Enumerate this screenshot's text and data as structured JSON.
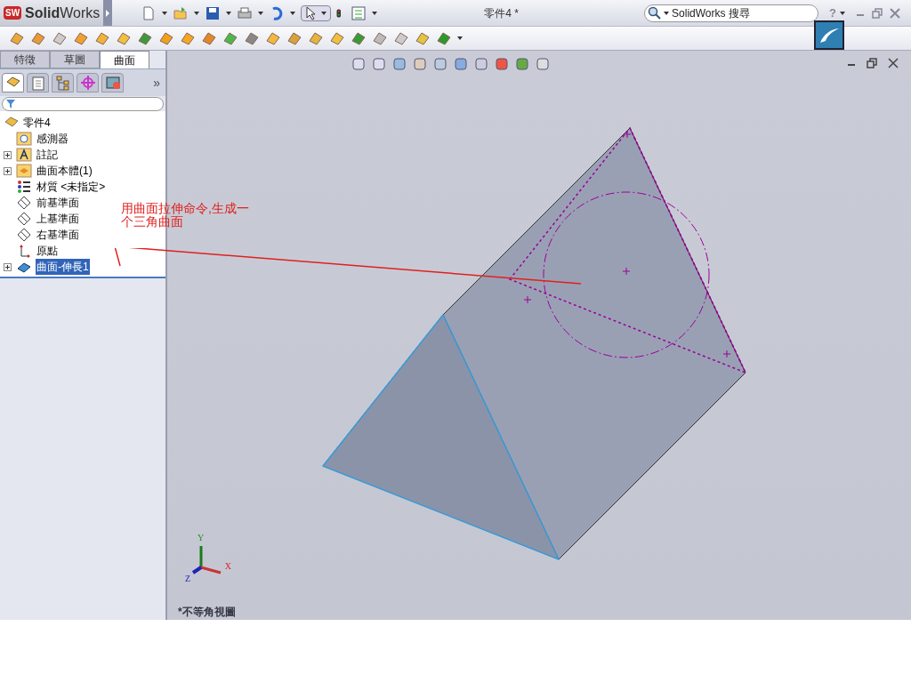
{
  "app": {
    "badge": "SW",
    "name_bold": "Solid",
    "name_rest": "Works"
  },
  "window": {
    "title": "零件4 *"
  },
  "search": {
    "placeholder": "SolidWorks 搜尋"
  },
  "help": "?",
  "tabs": [
    {
      "label": "特徵",
      "selected": false
    },
    {
      "label": "草圖",
      "selected": false
    },
    {
      "label": "曲面",
      "selected": true
    }
  ],
  "panel_tabs": [
    {
      "kind": "tree",
      "selected": true
    },
    {
      "kind": "properties",
      "selected": false
    },
    {
      "kind": "config",
      "selected": false
    },
    {
      "kind": "target",
      "selected": false
    },
    {
      "kind": "display",
      "selected": false
    }
  ],
  "panel_more": "»",
  "tree": {
    "label": "零件4",
    "kind": "part",
    "children": [
      {
        "label": "感測器",
        "kind": "sensor",
        "expandable": false,
        "selected": false
      },
      {
        "label": "註記",
        "kind": "annotation",
        "expandable": true,
        "expanded": false,
        "selected": false
      },
      {
        "label": "曲面本體(1)",
        "kind": "bodies",
        "expandable": true,
        "expanded": false,
        "selected": false
      },
      {
        "label": "材質 <未指定>",
        "kind": "material",
        "expandable": false,
        "selected": false
      },
      {
        "label": "前基準面",
        "kind": "plane",
        "expandable": false,
        "selected": false
      },
      {
        "label": "上基準面",
        "kind": "plane",
        "expandable": false,
        "selected": false
      },
      {
        "label": "右基準面",
        "kind": "plane",
        "expandable": false,
        "selected": false
      },
      {
        "label": "原點",
        "kind": "origin",
        "expandable": false,
        "selected": false
      },
      {
        "label": "曲面-伸長1",
        "kind": "extrude",
        "expandable": true,
        "expanded": false,
        "selected": true
      }
    ]
  },
  "viewport": {
    "view_name": "*不等角視圖",
    "axes": {
      "x": "X",
      "y": "Y",
      "z": "Z"
    }
  },
  "note": {
    "lines": [
      "用曲面拉伸命令,生成一",
      "个三角曲面"
    ]
  }
}
